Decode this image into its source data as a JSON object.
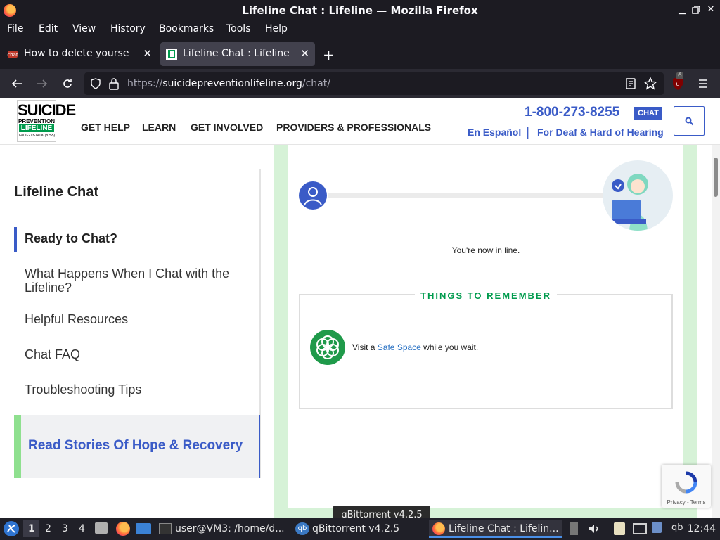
{
  "window": {
    "title": "Lifeline Chat : Lifeline — Mozilla Firefox"
  },
  "menubar": [
    "File",
    "Edit",
    "View",
    "History",
    "Bookmarks",
    "Tools",
    "Help"
  ],
  "tabs": [
    {
      "label": "How to delete yourself fr",
      "active": false
    },
    {
      "label": "Lifeline Chat : Lifeline",
      "active": true
    }
  ],
  "urlbar": {
    "url_prefix": "https://",
    "url_domain": "suicidepreventionlifeline.org",
    "url_path": "/chat/"
  },
  "extension_badge": "6",
  "site": {
    "logo": {
      "line1": "SUICIDE",
      "line2": "PREVENTION",
      "line3": "LIFELINE",
      "line4": "1-800-273-TALK (8255)"
    },
    "nav": [
      "GET HELP",
      "LEARN",
      "GET INVOLVED",
      "PROVIDERS & PROFESSIONALS"
    ],
    "phone": "1-800-273-8255",
    "chat_badge": "CHAT",
    "espanol": "En Español",
    "separator": "|",
    "deaf": "For Deaf & Hard of Hearing"
  },
  "sidebar": {
    "title": "Lifeline Chat",
    "items": [
      {
        "label": "Ready to Chat?",
        "active": true
      },
      {
        "label": "What Happens When I Chat with the Lifeline?",
        "active": false
      },
      {
        "label": "Helpful Resources",
        "active": false
      },
      {
        "label": "Chat FAQ",
        "active": false
      },
      {
        "label": "Troubleshooting Tips",
        "active": false
      }
    ],
    "stories": "Read Stories Of Hope & Recovery"
  },
  "chat": {
    "status": "You're now in line.",
    "remember_title": "THINGS TO REMEMBER",
    "safe_prefix": "Visit a ",
    "safe_link": "Safe Space",
    "safe_suffix": " while you wait."
  },
  "recaptcha": {
    "links": "Privacy - Terms"
  },
  "tooltip": "qBittorrent v4.2.5",
  "taskbar": {
    "workspaces": [
      "1",
      "2",
      "3",
      "4"
    ],
    "apps": [
      {
        "label": "user@VM3: /home/d..."
      },
      {
        "label": "qBittorrent v4.2.5"
      },
      {
        "label": "Lifeline Chat : Lifelin..."
      }
    ],
    "clock": "12:44"
  },
  "colors": {
    "brand_blue": "#3a5bc7",
    "brand_green": "#009b4d",
    "panel_green": "#d6f2d7"
  }
}
